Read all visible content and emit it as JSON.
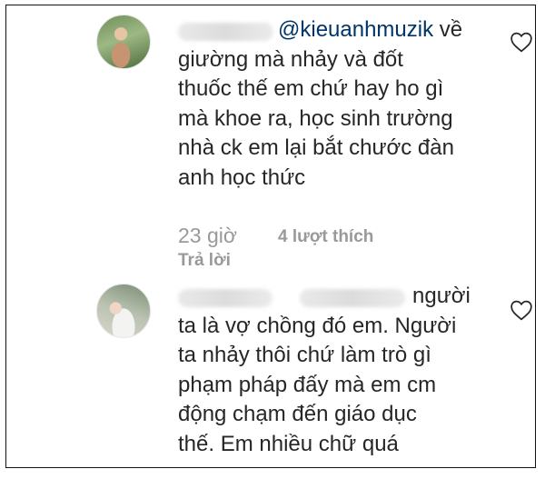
{
  "comments": [
    {
      "mention": "@kieuanhmuzik",
      "lines": [
        "về",
        "giường mà nhảy và đốt",
        "thuốc thế em chứ hay ho gì",
        "mà khoe ra, học sinh trường",
        "nhà ck em lại bắt chước đàn",
        "anh học thức"
      ],
      "time": "23 giờ",
      "likes": "4 lượt thích",
      "reply": "Trả lời",
      "like_icon": "heart-outline-icon"
    },
    {
      "lines": [
        "người",
        "ta là vợ chồng đó em. Người",
        "ta nhảy thôi chứ làm trò gì",
        "phạm pháp đấy mà em cm",
        "động chạm đến giáo dục",
        "thế. Em nhiều chữ quá"
      ],
      "like_icon": "heart-outline-icon"
    }
  ],
  "colors": {
    "text": "#262626",
    "mention": "#003569",
    "meta": "#999999"
  }
}
